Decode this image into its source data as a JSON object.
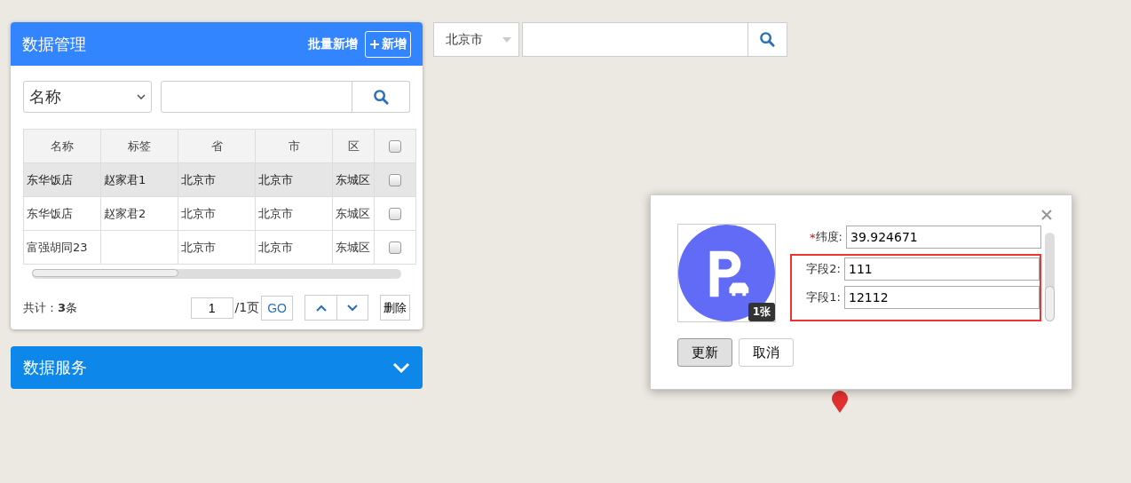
{
  "panel": {
    "title": "数据管理",
    "batch_add": "批量新增",
    "add_button": "新增",
    "filter": {
      "field": "名称"
    },
    "table": {
      "columns": [
        "名称",
        "标签",
        "省",
        "市",
        "区"
      ],
      "rows": [
        {
          "cells": [
            "东华饭店",
            "赵家君1",
            "北京市",
            "北京市",
            "东城区"
          ],
          "selected": true,
          "checked": false
        },
        {
          "cells": [
            "东华饭店",
            "赵家君2",
            "北京市",
            "北京市",
            "东城区"
          ],
          "selected": false,
          "checked": false
        },
        {
          "cells": [
            "富强胡同23",
            "",
            "北京市",
            "北京市",
            "东城区"
          ],
          "selected": false,
          "checked": false
        }
      ],
      "all_checked": false
    },
    "footer": {
      "total": "共计：**3**条",
      "page": "1",
      "page_total": "/1页",
      "go": "GO",
      "delete": "删除"
    }
  },
  "service_panel": {
    "title": "数据服务",
    "expanded": false
  },
  "city_search": {
    "city": "北京市"
  },
  "popup": {
    "badge": "1张",
    "fields": [
      {
        "required_mark": "*",
        "label": "纬度:",
        "value": "39.924671",
        "highlighted": false
      },
      {
        "label": "字段2:",
        "value": "111",
        "highlighted": true
      },
      {
        "label": "字段1:",
        "value": "12112",
        "highlighted": true
      }
    ],
    "buttons": [
      {
        "label": "更新",
        "selected": true
      },
      {
        "label": "取消",
        "selected": false
      }
    ]
  }
}
